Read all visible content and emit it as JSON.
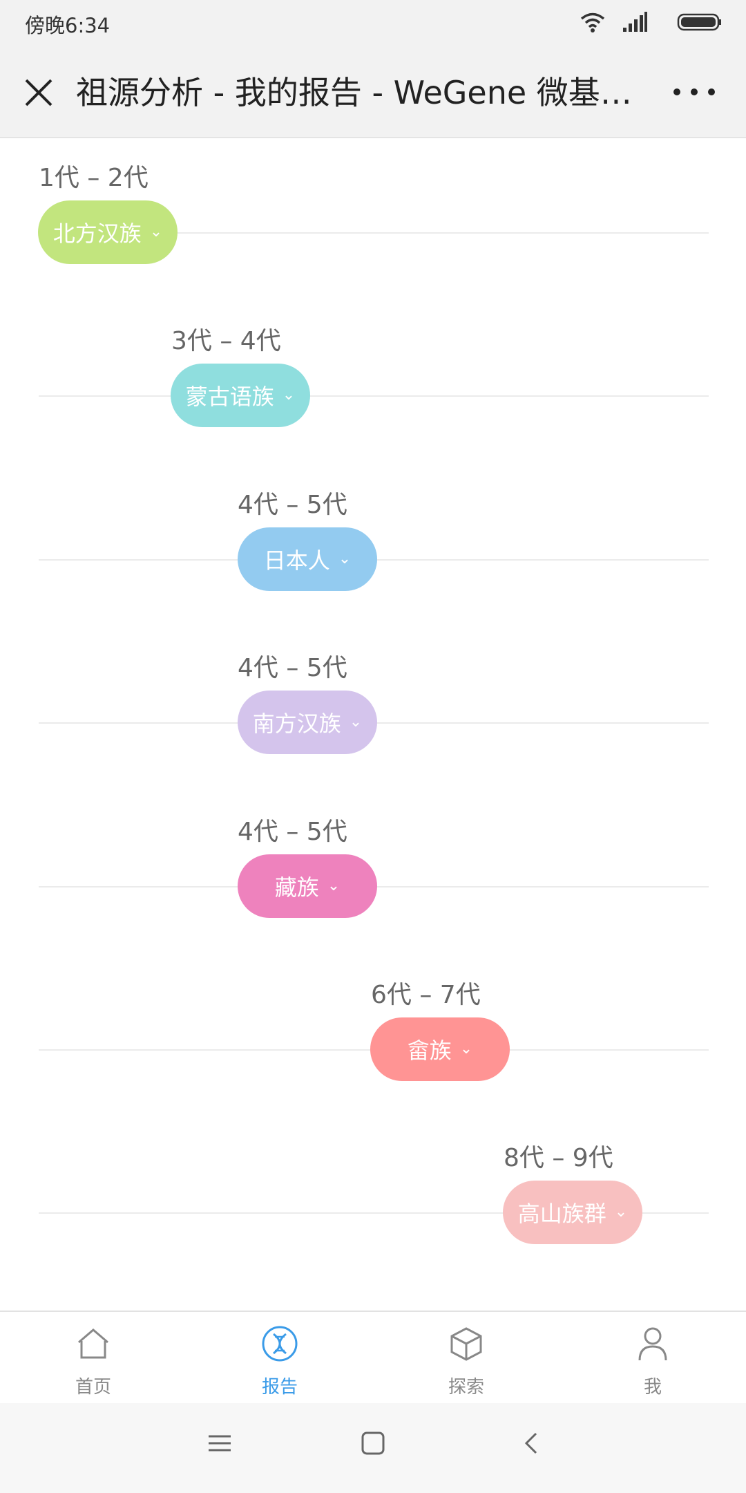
{
  "status": {
    "time": "傍晚6:34"
  },
  "nav": {
    "title": "祖源分析 - 我的报告 - WeGene 微基因..."
  },
  "rows": [
    {
      "generation": "1代 – 2代",
      "label": "北方汉族",
      "color": "#c2e57e"
    },
    {
      "generation": "3代 – 4代",
      "label": "蒙古语族",
      "color": "#8fdede"
    },
    {
      "generation": "4代 – 5代",
      "label": "日本人",
      "color": "#93cbf0"
    },
    {
      "generation": "4代 – 5代",
      "label": "南方汉族",
      "color": "#d4c4ec"
    },
    {
      "generation": "4代 – 5代",
      "label": "藏族",
      "color": "#ee82bd"
    },
    {
      "generation": "6代 – 7代",
      "label": "畲族",
      "color": "#ff9494"
    },
    {
      "generation": "8代 – 9代",
      "label": "高山族群",
      "color": "#f8c0c0"
    }
  ],
  "tabs": [
    {
      "label": "首页",
      "icon": "home-icon",
      "active": false
    },
    {
      "label": "报告",
      "icon": "dna-icon",
      "active": true
    },
    {
      "label": "探索",
      "icon": "cube-icon",
      "active": false
    },
    {
      "label": "我",
      "icon": "person-icon",
      "active": false
    }
  ],
  "system_nav": [
    "menu-icon",
    "home-square-icon",
    "back-icon"
  ]
}
